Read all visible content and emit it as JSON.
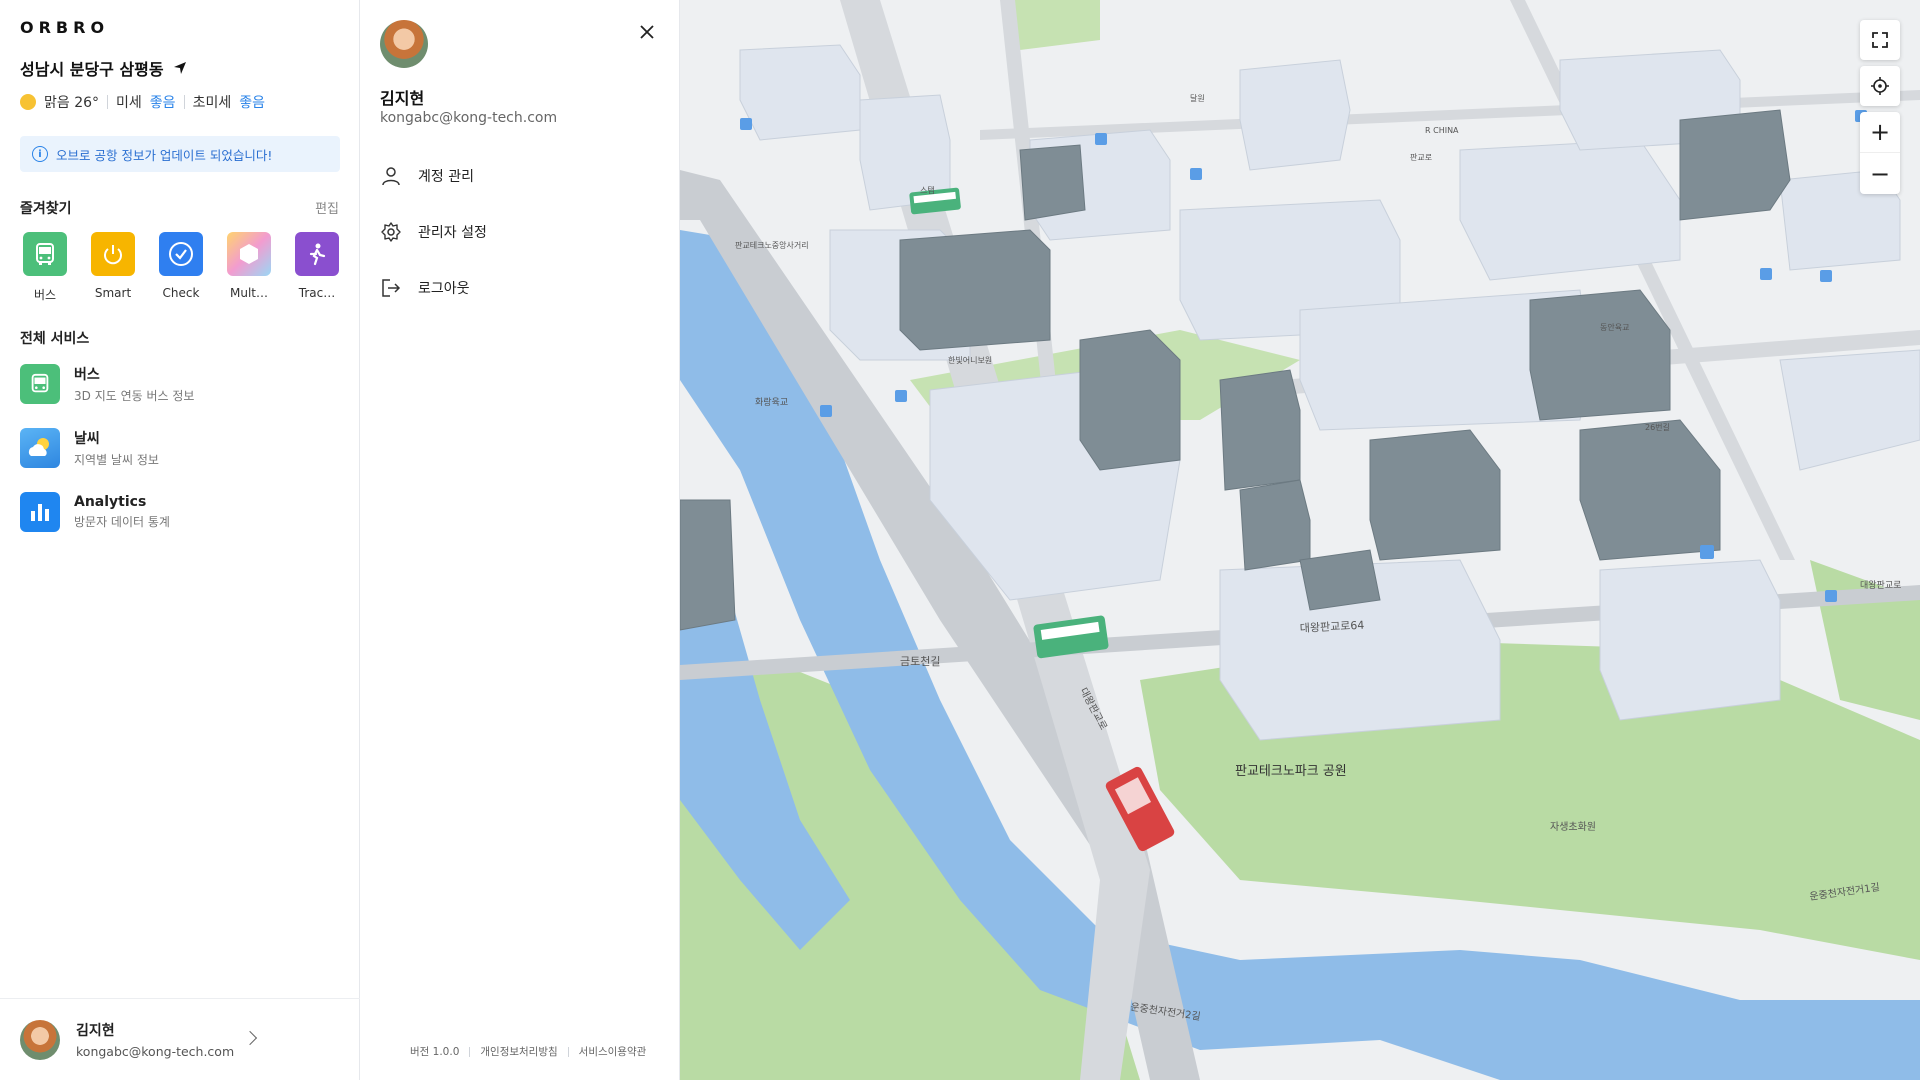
{
  "brand": {
    "logo": "ORBRO"
  },
  "location": {
    "name": "성남시 분당구 삼평동"
  },
  "weather": {
    "condition": "맑음 26°",
    "fine_dust_label": "미세",
    "fine_dust_value": "좋음",
    "ultra_fine_dust_label": "초미세",
    "ultra_fine_dust_value": "좋음"
  },
  "notice": {
    "text": "오브로 공항 정보가 업데이트 되었습니다!"
  },
  "favorites": {
    "title": "즐겨찾기",
    "edit_label": "편집",
    "items": [
      {
        "label": "버스",
        "icon": "bus-icon",
        "color": "#4cbf7a"
      },
      {
        "label": "Smart",
        "icon": "power-icon",
        "color": "#f7b500"
      },
      {
        "label": "Check",
        "icon": "check-circle-icon",
        "color": "#2f7ff0"
      },
      {
        "label": "Mult…",
        "icon": "cube-icon",
        "color": "#f29ccf"
      },
      {
        "label": "Trac…",
        "icon": "walk-icon",
        "color": "#8a4fcf"
      }
    ]
  },
  "services": {
    "title": "전체 서비스",
    "items": [
      {
        "name": "버스",
        "desc": "3D 지도 연동 버스 정보",
        "icon": "bus-icon"
      },
      {
        "name": "날씨",
        "desc": "지역별 날씨 정보",
        "icon": "weather-icon"
      },
      {
        "name": "Analytics",
        "desc": "방문자 데이터 통계",
        "icon": "analytics-icon"
      }
    ]
  },
  "user": {
    "name": "김지현",
    "email": "kongabc@kong-tech.com"
  },
  "panel": {
    "menu": [
      {
        "label": "계정 관리",
        "icon": "user-icon"
      },
      {
        "label": "관리자 설정",
        "icon": "gear-icon"
      },
      {
        "label": "로그아웃",
        "icon": "logout-icon"
      }
    ],
    "footer": {
      "version": "버전 1.0.0",
      "privacy": "개인정보처리방침",
      "terms": "서비스이용약관"
    }
  },
  "map": {
    "park_label": "판교테크노파크 공원",
    "labels": [
      {
        "text": "대왕판교로64"
      },
      {
        "text": "금토천길"
      },
      {
        "text": "자생초화원"
      },
      {
        "text": "운중천자전거1길"
      },
      {
        "text": "운중천자전거2길"
      },
      {
        "text": "대왕판교로"
      },
      {
        "text": "화랑육교"
      },
      {
        "text": "판교테크노중앙사거리"
      },
      {
        "text": "R CHINA"
      },
      {
        "text": "판교로"
      },
      {
        "text": "동안육교"
      },
      {
        "text": "26번길"
      },
      {
        "text": "한빛어니보원"
      },
      {
        "text": "스탬"
      },
      {
        "text": "달원"
      },
      {
        "text": "대왕판교로"
      }
    ],
    "controls": {
      "zoom_in": "+",
      "zoom_out": "−"
    }
  }
}
